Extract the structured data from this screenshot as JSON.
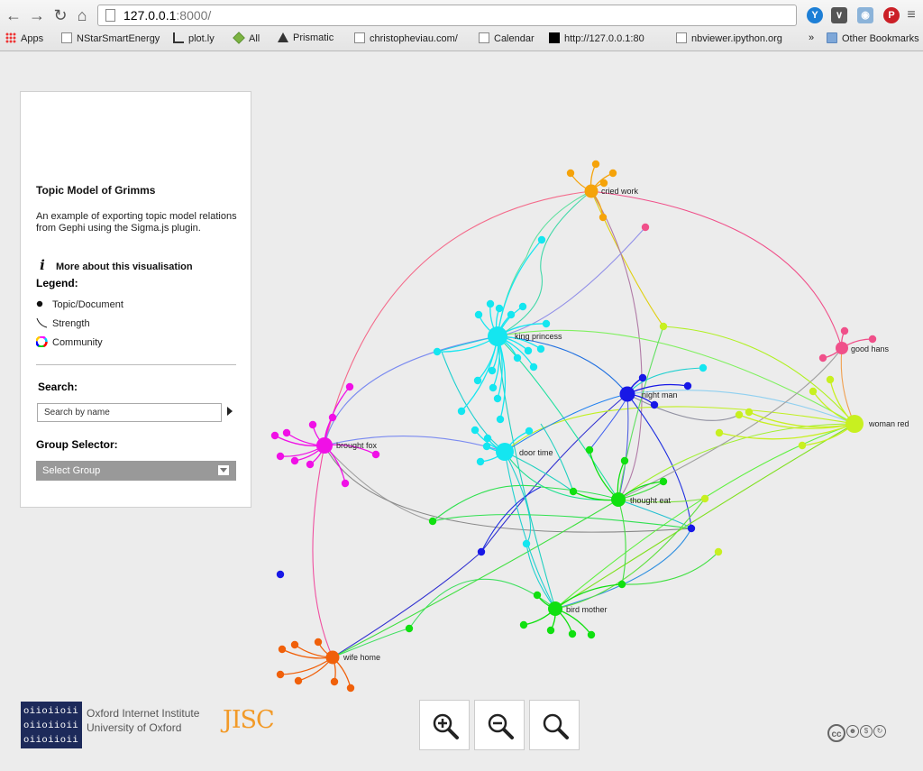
{
  "browser": {
    "url_host": "127.0.0.1",
    "url_rest": ":8000/",
    "bookmarks": [
      "Apps",
      "NStarSmartEnergy",
      "plot.ly",
      "All",
      "Prismatic",
      "christopheviau.com/",
      "Calendar",
      "http://127.0.0.1:80",
      "nbviewer.ipython.org",
      "Other Bookmarks"
    ],
    "overflow": "»"
  },
  "panel": {
    "title": "Topic Model of Grimms",
    "description": "An example of exporting topic model relations from Gephi using the Sigma.js plugin.",
    "more_link": "More about this visualisation",
    "legend_title": "Legend:",
    "legend": [
      "Topic/Document",
      "Strength",
      "Community"
    ],
    "search_title": "Search:",
    "search_placeholder": "Search by name",
    "group_title": "Group Selector:",
    "group_select": "Select Group"
  },
  "graph_labels": {
    "cried_work": "cried work",
    "king_princess": "king princess",
    "good_hans": "good hans",
    "night_man": "night man",
    "woman_red": "woman red",
    "brought_fox": "brought fox",
    "door_time": "door time",
    "thought_eat": "thought eat",
    "bird_mother": "bird mother",
    "wife_home": "wife home"
  },
  "colors": {
    "cyan": "#14e6f0",
    "orange": "#f5a30a",
    "pink": "#f0508a",
    "blue": "#1818e6",
    "lime": "#c8f020",
    "magenta": "#f010e6",
    "green": "#10e010",
    "red_orange": "#f0600a"
  },
  "footer": {
    "oii_logo_rows": [
      "oiioiioii",
      "oiioiioii",
      "oiioiioii"
    ],
    "oii_line1": "Oxford Internet Institute",
    "oii_line2": "University of Oxford",
    "jisc": "JISC",
    "zoom_in": "zoom-in",
    "zoom_out": "zoom-out",
    "zoom_reset": "zoom-reset",
    "cc": "cc"
  }
}
